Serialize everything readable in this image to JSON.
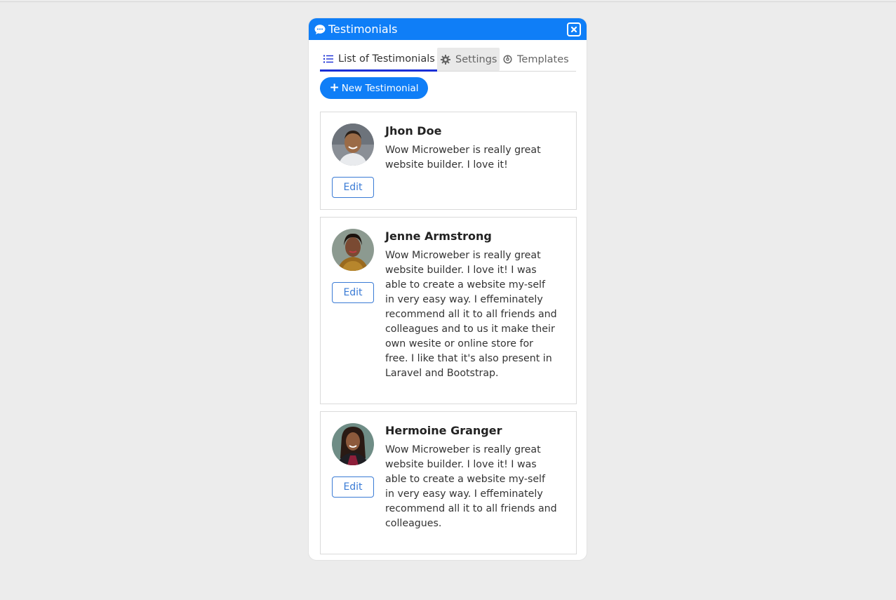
{
  "modal": {
    "title": "Testimonials",
    "header_icon": "chat-bubble-icon",
    "close_icon": "close-icon",
    "accent_color": "#0f7ef7"
  },
  "tabs": [
    {
      "label": "List of Testimonials",
      "icon": "list-icon",
      "active": true
    },
    {
      "label": "Settings",
      "icon": "gear-icon",
      "active": false
    },
    {
      "label": "Templates",
      "icon": "templates-icon",
      "active": false
    }
  ],
  "new_button": {
    "label": "New Testimonial",
    "icon": "plus-icon"
  },
  "testimonials": [
    {
      "name": "Jhon Doe",
      "text": "Wow Microweber is really great website builder. I love it!",
      "edit_label": "Edit"
    },
    {
      "name": "Jenne Armstrong",
      "text": "Wow Microweber is really great website builder. I love it! I was able to create a website my-self in very easy way. I effeminately recommend all it to all friends and colleagues and to us it make their own wesite or online store for free. I like that it's also present in Laravel and Bootstrap.",
      "edit_label": "Edit"
    },
    {
      "name": "Hermoine Granger",
      "text": "Wow Microweber is really great website builder. I love it! I was able to create a website my-self in very easy way. I effeminately recommend all it to all friends and colleagues.",
      "edit_label": "Edit"
    }
  ]
}
